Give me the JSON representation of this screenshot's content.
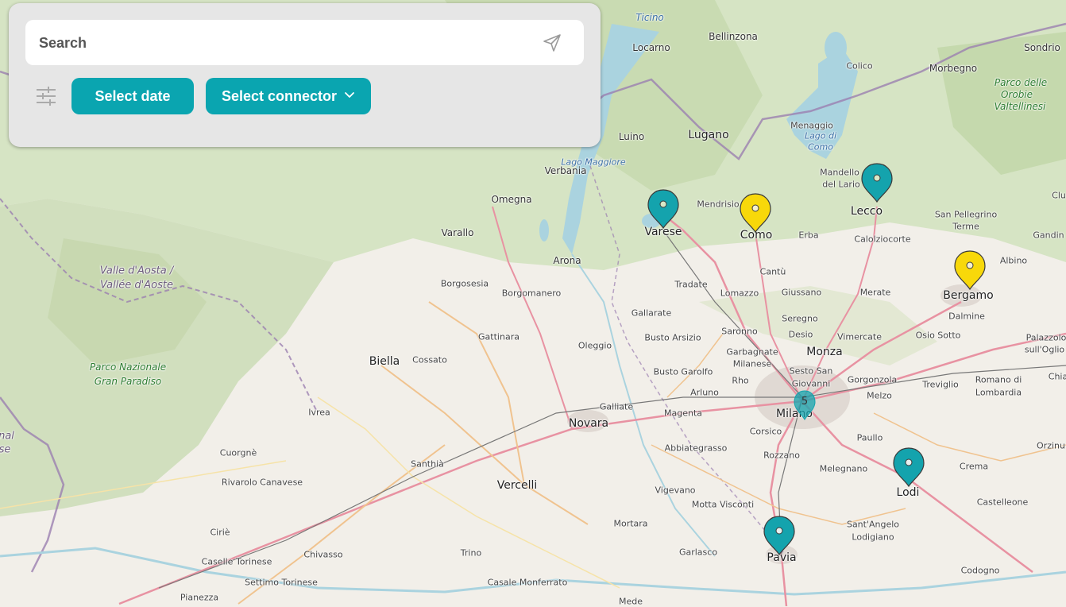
{
  "search": {
    "placeholder": "Search"
  },
  "filters": {
    "date_label": "Select date",
    "connector_label": "Select connector"
  },
  "icons": {
    "send": "send-icon",
    "filter": "filter-sliders-icon",
    "dropdown": "chevron-down-icon"
  },
  "colors": {
    "accent": "#0aa5b0",
    "marker_teal": "#14a3ad",
    "marker_yellow": "#f8d80a",
    "panel_bg": "#e6e6e6"
  },
  "map": {
    "cluster_count": "5",
    "markers": [
      {
        "name": "Varese",
        "color": "teal"
      },
      {
        "name": "Como",
        "color": "yellow"
      },
      {
        "name": "Lecco",
        "color": "teal"
      },
      {
        "name": "Bergamo",
        "color": "yellow"
      },
      {
        "name": "Lodi",
        "color": "teal"
      },
      {
        "name": "Pavia",
        "color": "teal"
      }
    ],
    "labels": {
      "ticino": "Ticino",
      "bellinzona": "Bellinzona",
      "locarno": "Locarno",
      "sondrio": "Sondrio",
      "colico": "Colico",
      "morbegno": "Morbegno",
      "parco_orobie_1": "Parco delle",
      "parco_orobie_2": "Orobie",
      "parco_orobie_3": "Valtellinesi",
      "luino": "Luino",
      "lugano": "Lugano",
      "menaggio": "Menaggio",
      "lago_como_1": "Lago di",
      "lago_como_2": "Como",
      "lago_maggiore": "Lago Maggiore",
      "verbania": "Verbania",
      "mandello_1": "Mandello",
      "mandello_2": "del Lario",
      "omegna": "Omegna",
      "mendrisio": "Mendrisio",
      "varese": "Varese",
      "como": "Como",
      "lecco": "Lecco",
      "san_pellegrino_1": "San Pellegrino",
      "san_pellegrino_2": "Terme",
      "clu": "Clu",
      "varallo": "Varallo",
      "erba": "Erba",
      "calolziocorte": "Calolziocorte",
      "gandin": "Gandin",
      "arona": "Arona",
      "albino": "Albino",
      "valle_aosta_1": "Valle d'Aosta /",
      "valle_aosta_2": "Vallée d'Aoste",
      "borgosesia": "Borgosesia",
      "cantu": "Cantù",
      "tradate": "Tradate",
      "borgomanero": "Borgomanero",
      "lomazzo": "Lomazzo",
      "giussano": "Giussano",
      "merate": "Merate",
      "bergamo": "Bergamo",
      "gallarate": "Gallarate",
      "seregno": "Seregno",
      "dalmine": "Dalmine",
      "saronno": "Saronno",
      "gattinara": "Gattinara",
      "busto_arsizio": "Busto Arsizio",
      "desio": "Desio",
      "vimercate": "Vimercate",
      "osio_sotto": "Osio Sotto",
      "palazzolo_1": "Palazzolo",
      "palazzolo_2": "sull'Oglio",
      "oleggio": "Oleggio",
      "garbagnate_1": "Garbagnate",
      "garbagnate_2": "Milanese",
      "monza": "Monza",
      "biella": "Biella",
      "cossato": "Cossato",
      "parco_gp_1": "Parco Nazionale",
      "parco_gp_2": "Gran Paradiso",
      "busto_garolfo": "Busto Garolfo",
      "sesto_1": "Sesto San",
      "sesto_2": "Giovanni",
      "gorgonzola": "Gorgonzola",
      "chia": "Chia",
      "rho": "Rho",
      "treviglio": "Treviglio",
      "romano_1": "Romano di",
      "romano_2": "Lombardia",
      "arluno": "Arluno",
      "melzo": "Melzo",
      "ivrea": "Ivrea",
      "galliate": "Galliate",
      "magenta": "Magenta",
      "milano": "Milano",
      "novara": "Novara",
      "corsico": "Corsico",
      "paullo": "Paullo",
      "orzinu": "Orzinu",
      "cuorgne": "Cuorgnè",
      "abbiategrasso": "Abbiategrasso",
      "santhia": "Santhià",
      "rozzano": "Rozzano",
      "crema": "Crema",
      "melegnano": "Melegnano",
      "rivarolo": "Rivarolo Canavese",
      "vercelli": "Vercelli",
      "vigevano": "Vigevano",
      "lodi": "Lodi",
      "castelleone": "Castelleone",
      "motta_visconti": "Motta Visconti",
      "mortara": "Mortara",
      "santangelo_1": "Sant'Angelo",
      "santangelo_2": "Lodigiano",
      "cirie": "Ciriè",
      "chivasso": "Chivasso",
      "trino": "Trino",
      "garlasco": "Garlasco",
      "pavia": "Pavia",
      "caselle": "Caselle Torinese",
      "codogno": "Codogno",
      "settimo": "Settimo Torinese",
      "casale": "Casale Monferrato",
      "pianezza": "Pianezza",
      "mede": "Mede",
      "nal": "nal",
      "se": "se"
    }
  }
}
